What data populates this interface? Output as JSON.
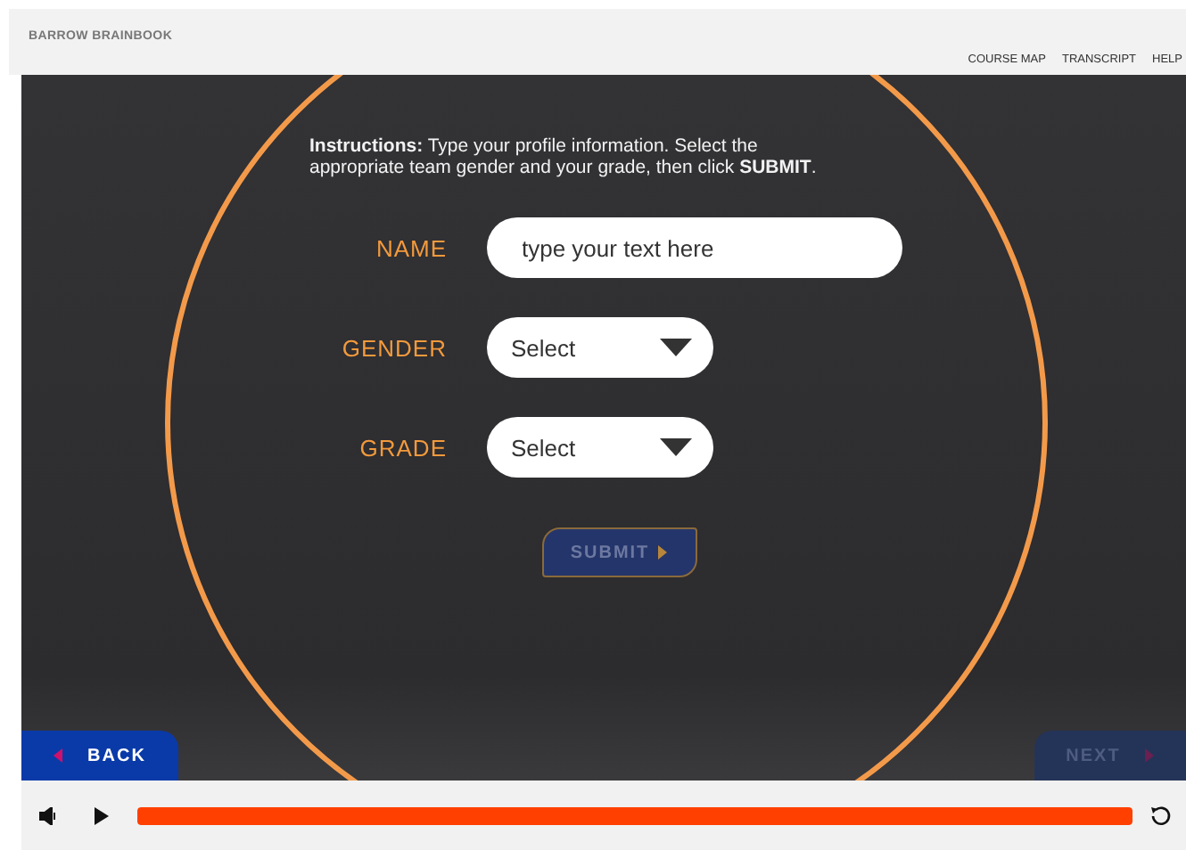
{
  "header": {
    "title": "BARROW BRAINBOOK",
    "links": [
      "COURSE MAP",
      "TRANSCRIPT",
      "HELP"
    ]
  },
  "instructions": "**Instructions:** Type your profile information. Select the appropriate team gender and your grade, then click **SUBMIT**.",
  "fields": [
    {
      "kind": "text",
      "label": "NAME",
      "placeholder": "type your text here"
    },
    {
      "kind": "select",
      "label": "GENDER",
      "value": "Select"
    },
    {
      "kind": "select",
      "label": "GRADE",
      "value": "Select"
    }
  ],
  "submit": {
    "label": "SUBMIT",
    "disabled": true
  },
  "nav": {
    "back": {
      "label": "BACK",
      "disabled": false
    },
    "next": {
      "label": "NEXT",
      "disabled": true
    }
  },
  "player": {
    "level": 1
  }
}
